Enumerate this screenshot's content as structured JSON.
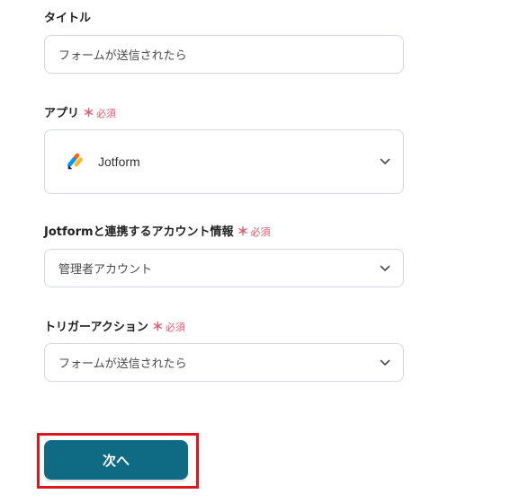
{
  "form": {
    "title_field": {
      "label": "タイトル",
      "value": "フォームが送信されたら"
    },
    "app_field": {
      "label": "アプリ",
      "required_mark": "＊",
      "required_text": "必須",
      "value": "Jotform",
      "icon": "jotform-logo-icon"
    },
    "account_field": {
      "label": "Jotformと連携するアカウント情報",
      "required_mark": "＊",
      "required_text": "必須",
      "value": "管理者アカウント"
    },
    "trigger_field": {
      "label": "トリガーアクション",
      "required_mark": "＊",
      "required_text": "必須",
      "value": "フォームが送信されたら"
    }
  },
  "next_button": {
    "label": "次へ",
    "highlighted": true
  },
  "colors": {
    "primary": "#0f6a84",
    "required": "#e4566c",
    "highlight": "#e0161e",
    "border": "#d5d9de"
  }
}
